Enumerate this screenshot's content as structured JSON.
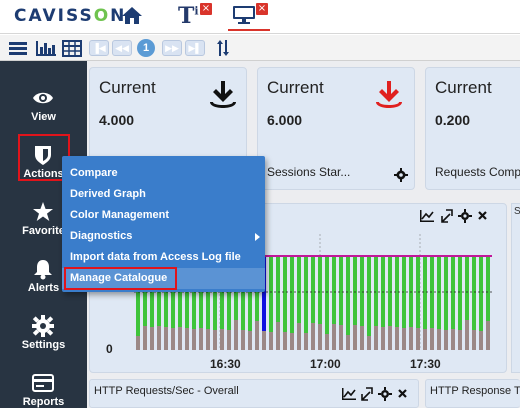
{
  "header": {
    "logo_prefix": "CAVISS",
    "logo_o": "O",
    "logo_suffix": "N",
    "tab_text_glyph": "T",
    "tab_text_sup": "i",
    "close_glyph": "×"
  },
  "toolbar": {
    "page": "1"
  },
  "sidebar": {
    "items": [
      {
        "label": "View",
        "icon": "eye-icon"
      },
      {
        "label": "Actions",
        "icon": "shield-icon"
      },
      {
        "label": "Favorite",
        "icon": "star-icon"
      },
      {
        "label": "Alerts",
        "icon": "bell-icon"
      },
      {
        "label": "Settings",
        "icon": "gear-icon"
      },
      {
        "label": "Reports",
        "icon": "report-card-icon"
      }
    ]
  },
  "cards": [
    {
      "title": "Current",
      "value": "4.000",
      "foot": "",
      "icon": "download-arrow-icon",
      "icon_color": "#111111"
    },
    {
      "title": "Current",
      "value": "6.000",
      "foot": "Sessions Star...",
      "icon": "download-arrow-icon",
      "icon_color": "#e0201f"
    },
    {
      "title": "Current",
      "value": "0.200",
      "foot": "Requests Comp...",
      "icon": "",
      "icon_color": ""
    }
  ],
  "chart": {
    "x_ticks": [
      "16:30",
      "17:00",
      "17:30"
    ],
    "y_tick": "0",
    "colors": {
      "green": "#3ec43a",
      "gray": "#9b8886",
      "magenta": "#c1179a",
      "blue": "#1010e0",
      "panel": "#dfe8f4"
    }
  },
  "bottom_panels": [
    {
      "title": "HTTP Requests/Sec - Overall"
    },
    {
      "title": "HTTP Response Ti"
    }
  ],
  "right_edge_label": "S",
  "actions_menu": {
    "items": [
      {
        "label": "Compare",
        "submenu": false
      },
      {
        "label": "Derived Graph",
        "submenu": false
      },
      {
        "label": "Color Management",
        "submenu": false
      },
      {
        "label": "Diagnostics",
        "submenu": true
      },
      {
        "label": "Import data from Access Log file",
        "submenu": false
      },
      {
        "label": "Manage Catalogue",
        "submenu": false
      }
    ]
  }
}
